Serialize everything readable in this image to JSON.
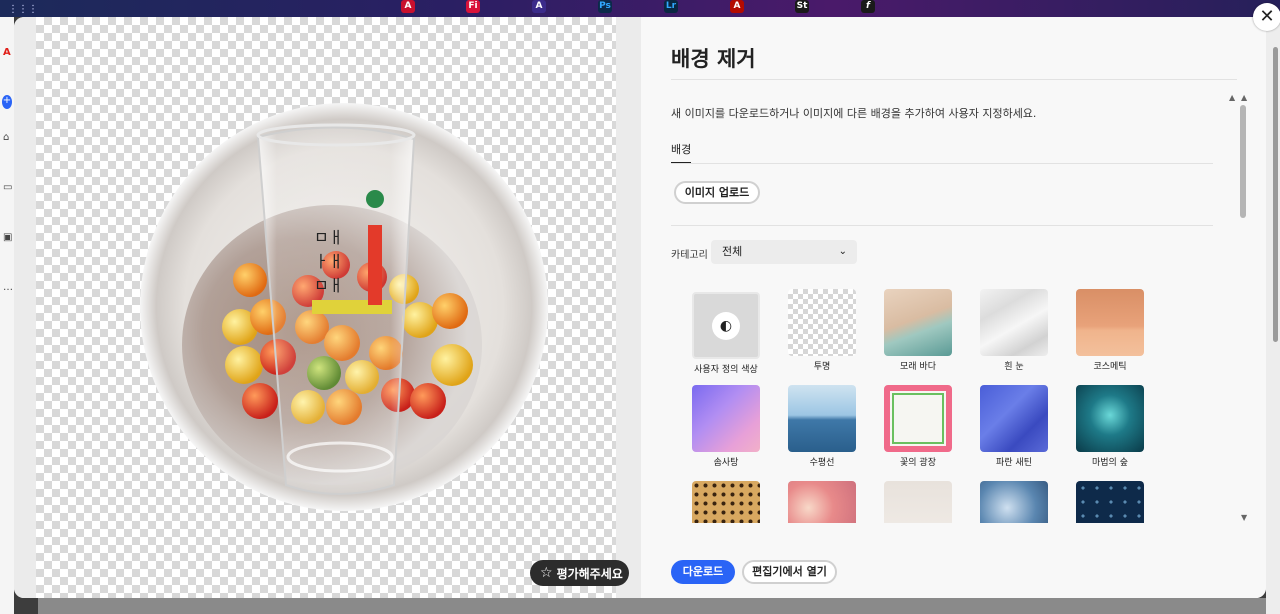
{
  "dock": {
    "apps": [
      {
        "name": "acrobat-cloud",
        "glyph": "A",
        "color": "#c8102e"
      },
      {
        "name": "fresco",
        "glyph": "Fi",
        "color": "#d9123a"
      },
      {
        "name": "express",
        "glyph": "A",
        "color": "#3b2b8a"
      },
      {
        "name": "photoshop",
        "glyph": "Ps",
        "color": "#0b2a4a"
      },
      {
        "name": "lightroom",
        "glyph": "Lr",
        "color": "#0a2742"
      },
      {
        "name": "acrobat",
        "glyph": "A",
        "color": "#b30b00"
      },
      {
        "name": "stock",
        "glyph": "St",
        "color": "#1a1a1a"
      },
      {
        "name": "fonts",
        "glyph": "f",
        "color": "#1a1a1a"
      }
    ]
  },
  "dialog": {
    "title": "배경 제거",
    "description": "새 이미지를 다운로드하거나 이미지에 다른 배경을 추가하여 사용자 지정하세요.",
    "tab_label": "배경",
    "upload_button": "이미지 업로드",
    "category_label": "카테고리",
    "category_value": "전체",
    "rate_button": "평가해주세요",
    "download_button": "다운로드",
    "open_editor_button": "편집기에서 열기",
    "close_label": "✕"
  },
  "backgrounds": [
    {
      "label": "사용자 정의 색상",
      "icon": "palette-icon"
    },
    {
      "label": "투명"
    },
    {
      "label": "모래 바다"
    },
    {
      "label": "흰 눈"
    },
    {
      "label": "코스메틱"
    },
    {
      "label": "솜사탕"
    },
    {
      "label": "수평선"
    },
    {
      "label": "꽃의 광장"
    },
    {
      "label": "파란 새틴"
    },
    {
      "label": "마법의 숲"
    }
  ],
  "colors": {
    "accent": "#2a64f6",
    "preview_bg": "#ebebeb",
    "panel_bg": "#f8f8f8"
  }
}
